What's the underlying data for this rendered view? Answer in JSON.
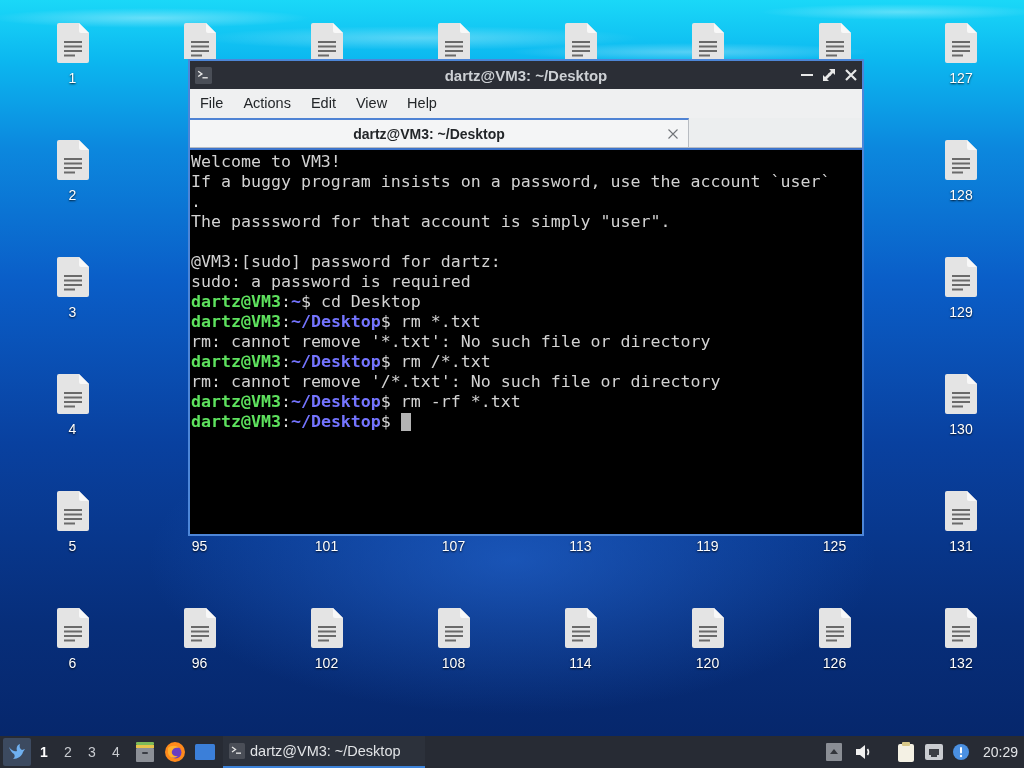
{
  "desktop": {
    "left_column": [
      {
        "label": "1"
      },
      {
        "label": "2"
      },
      {
        "label": "3"
      },
      {
        "label": "4"
      },
      {
        "label": "5"
      },
      {
        "label": "6"
      }
    ],
    "middle_columns": [
      {
        "label_below_window": "95",
        "bottom_label": "96"
      },
      {
        "label_below_window": "101",
        "bottom_label": "102"
      },
      {
        "label_below_window": "107",
        "bottom_label": "108"
      },
      {
        "label_below_window": "113",
        "bottom_label": "114"
      },
      {
        "label_below_window": "119",
        "bottom_label": "120"
      },
      {
        "label_below_window": "125",
        "bottom_label": "126"
      }
    ],
    "right_column": [
      {
        "label": "127"
      },
      {
        "label": "128"
      },
      {
        "label": "129"
      },
      {
        "label": "130"
      },
      {
        "label": "131"
      },
      {
        "label": "132"
      }
    ]
  },
  "window": {
    "title": "dartz@VM3: ~/Desktop",
    "menu": [
      "File",
      "Actions",
      "Edit",
      "View",
      "Help"
    ],
    "tabs": [
      {
        "label": "dartz@VM3: ~/Desktop",
        "selected": true
      }
    ],
    "terminal": {
      "blocks": [
        {
          "lines": [
            [
              {
                "kind": "text",
                "text": "Welcome to VM3!"
              }
            ],
            [
              {
                "kind": "text",
                "text": "If a buggy program insists on a password, use the account `user`"
              }
            ],
            [
              {
                "kind": "text",
                "text": "."
              }
            ],
            [
              {
                "kind": "text",
                "text": "The passsword for that account is simply \"user\"."
              }
            ]
          ]
        },
        {
          "lines": [
            [
              {
                "kind": "text",
                "text": "@VM3:[sudo] password for dartz:"
              }
            ],
            [
              {
                "kind": "text",
                "text": "sudo: a password is required"
              }
            ],
            [
              {
                "kind": "user",
                "text": "dartz@VM3"
              },
              {
                "kind": "text",
                "text": ":"
              },
              {
                "kind": "path",
                "text": "~"
              },
              {
                "kind": "text",
                "text": "$ cd Desktop"
              }
            ],
            [
              {
                "kind": "user",
                "text": "dartz@VM3"
              },
              {
                "kind": "text",
                "text": ":"
              },
              {
                "kind": "path",
                "text": "~/Desktop"
              },
              {
                "kind": "text",
                "text": "$ rm *.txt"
              }
            ],
            [
              {
                "kind": "text",
                "text": "rm: cannot remove '*.txt': No such file or directory"
              }
            ],
            [
              {
                "kind": "user",
                "text": "dartz@VM3"
              },
              {
                "kind": "text",
                "text": ":"
              },
              {
                "kind": "path",
                "text": "~/Desktop"
              },
              {
                "kind": "text",
                "text": "$ rm /*.txt"
              }
            ],
            [
              {
                "kind": "text",
                "text": "rm: cannot remove '/*.txt': No such file or directory"
              }
            ],
            [
              {
                "kind": "user",
                "text": "dartz@VM3"
              },
              {
                "kind": "text",
                "text": ":"
              },
              {
                "kind": "path",
                "text": "~/Desktop"
              },
              {
                "kind": "text",
                "text": "$ rm -rf *.txt"
              }
            ],
            [
              {
                "kind": "user",
                "text": "dartz@VM3"
              },
              {
                "kind": "text",
                "text": ":"
              },
              {
                "kind": "path",
                "text": "~/Desktop"
              },
              {
                "kind": "text",
                "text": "$"
              }
            ]
          ]
        }
      ],
      "cursor": true
    }
  },
  "taskbar": {
    "workspaces": [
      {
        "label": "1",
        "selected": true
      },
      {
        "label": "2",
        "selected": false
      },
      {
        "label": "3",
        "selected": false
      },
      {
        "label": "4",
        "selected": false
      }
    ],
    "tasks": [
      {
        "title": "dartz@VM3: ~/Desktop",
        "active": true
      }
    ],
    "clock": "20:29"
  }
}
